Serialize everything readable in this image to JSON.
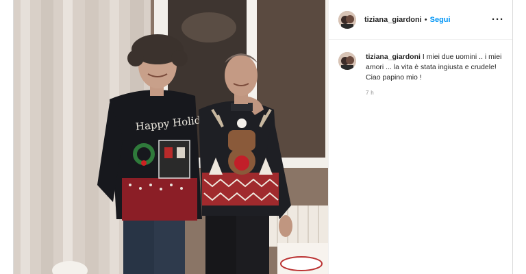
{
  "post": {
    "photo_alt": "",
    "username": "tiziana_giardoni",
    "separator": "•",
    "follow_label": "Segui",
    "more_label": "···",
    "caption": {
      "username": "tiziana_giardoni",
      "text": "I miei due uomini .. i miei amori ... la vita è stata ingiusta e crudele! Ciao papino mio !",
      "timestamp": "7 h"
    },
    "sweater_text": "Happy Holidays"
  },
  "colors": {
    "follow_blue": "#0095f6",
    "text": "#262626",
    "muted": "#8e8e8e",
    "border": "#dbdbdb"
  }
}
